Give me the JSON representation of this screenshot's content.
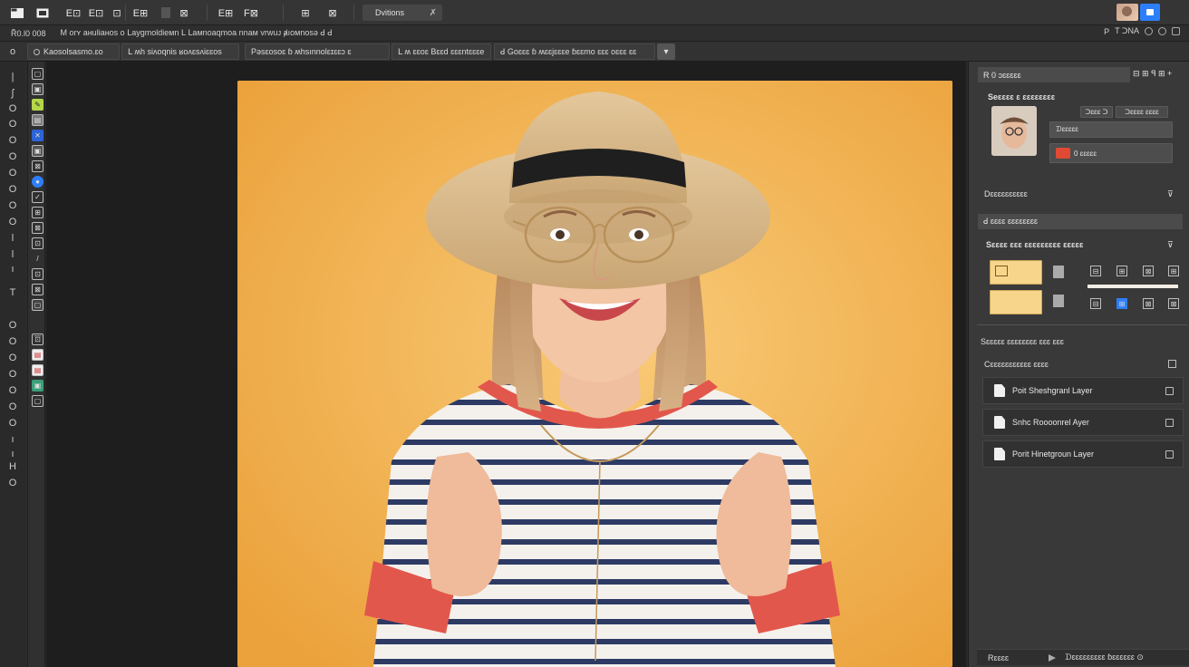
{
  "toolbar": {
    "icons": [
      "file-icon",
      "folder-icon",
      "grid-icon",
      "frame-icon",
      "crop-icon",
      "marquee-icon",
      "layers-icon",
      "transform-icon",
      "type-icon",
      "shape-icon",
      "panel-icon",
      "export-icon"
    ],
    "labels": [
      "",
      "",
      "E⊡",
      "⊡",
      "E⊞",
      "",
      "⊠",
      "E⊞",
      "F⊠",
      "⊠",
      "⊞",
      "⊠"
    ],
    "doc_label": "Dvitions",
    "doc_close": "✗"
  },
  "menubar": {
    "left": "R̃0.l0 008",
    "items": "M ᴏrʏ aнuliaнos o ꓡaygmoldieᴍn ꓡ ꓡaᴍnoaqmoa nnaᴍ vrwuᴊ ⱥıoᴍnosə ꓒ ꓒ",
    "right_p": "P",
    "right_label": "T ᑐNA"
  },
  "tabs": [
    {
      "label": "Kaosolsasmo.ɛo"
    },
    {
      "label": "ꓡ ʍh siʌoqnis ʁoʌɛsʌiɛɛos"
    },
    {
      "label": "Pəsɛosoɛ ɓ ʍhsınnolɛɪɛɛɔ ɛ"
    },
    {
      "label": "ꓡ ʍ ɛɛoɛ Bɛɛd ɛɛɛntɛɛɛe"
    },
    {
      "label": "ꓒ Goɛɛɛ ɓ ʍɛɛjɛɛɛe ɓɛɛmo ɛɛɛ oɛɛɛ ɛɛ"
    }
  ],
  "tab_plus": "▾",
  "right": {
    "panel1_title": "R 0 ɔɛɛɛɛɛ",
    "panel1_tools": "⊟ ⊞ ꟼ ⊞ +",
    "panel1_sub": "Seɛɛɛɛ ɛ ɛɛɛɛɛɛɛɛ",
    "btn_a": "ᑐɛɛɛ ᑐ",
    "btn_b": "ᑐɛɛɛɛ ɛɛɛɛ",
    "row_a": "ᗪɛɛɛɛɛ",
    "row_b": "0 ɛɛɛɛɛ",
    "section2": "Dɛɛɛɛɛɛɛɛɛɛ",
    "panel2_title": "ꓒ ɛɛɛɛ ɛɛɛɛɛɛɛɛ",
    "panel2_sub": "Sɛɛɛɛ ɛɛɛ ɛɛɛɛɛɛɛɛɛ ɛɛɛɛɛ",
    "section3": "Sɛɛɛɛɛ ɛɛɛɛɛɛɛɛ ɛɛɛ ɛɛɛ",
    "section4": "Cɛɛɛɛɛɛɛɛɛɛɛ ɛɛɛɛ",
    "layers": [
      {
        "label": "Poit Sheshgranl Layer"
      },
      {
        "label": "Snhc Roooonrel Ayer"
      },
      {
        "label": "Porit Hinetgroun Layer"
      }
    ],
    "status_left": "Rɛɛɛɛ",
    "status_right": "ᗪɛɛɛɛɛɛɛɛɛ ɓɛɛɛɛɛɛ ⊙"
  },
  "colors": {
    "accent_blue": "#2d7ff9",
    "swatch": "#f7d58b",
    "backdrop": "#f2b04a"
  }
}
